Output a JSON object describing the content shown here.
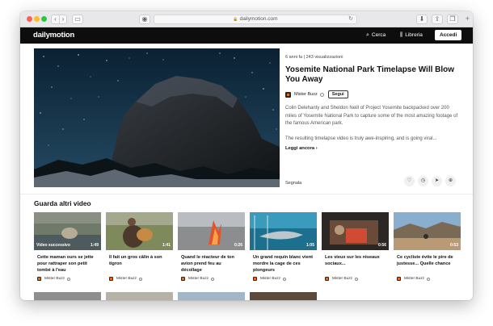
{
  "browser": {
    "url": "dailymotion.com"
  },
  "site": {
    "logo": "dailymotion",
    "search_label": "Cerca",
    "library_label": "Libreria",
    "login_label": "Accedi"
  },
  "video": {
    "meta_age": "6 anni fa",
    "meta_views": "243 visualizzazioni",
    "title": "Yosemite National Park Timelapse Will Blow You Away",
    "channel": "Mister Buzz",
    "follow_label": "Segui",
    "description_1": "Colin Delehanty and Sheldon Neill of Project Yosemite backpacked over 200 miles of Yosemite National Park to capture some of the most amazing footage of the famous American park.",
    "description_2": "The resulting timelapse video is truly awe-inspiring, and is going viral...",
    "read_more": "Leggi ancora",
    "report_label": "Segnala"
  },
  "related": {
    "section_title": "Guarda altri video",
    "items": [
      {
        "title": "Cette maman ours se jette pour rattraper son petit tombé à l'eau",
        "duration": "1:49",
        "badge": "Video successivo",
        "channel": "Mister Buzz"
      },
      {
        "title": "Il fait un gros câlin à son tigron",
        "duration": "1:41",
        "badge": "",
        "channel": "Mister Buzz"
      },
      {
        "title": "Quand le réacteur de ton avion prend feu au décollage",
        "duration": "0:26",
        "badge": "",
        "channel": "Mister Buzz"
      },
      {
        "title": "Un grand requin blanc vient mordre la cage de ces plongeurs",
        "duration": "1:05",
        "badge": "",
        "channel": "Mister Buzz"
      },
      {
        "title": "Les vieux sur les réseaux sociaux...",
        "duration": "0:56",
        "badge": "",
        "channel": "Mister Buzz"
      },
      {
        "title": "Ce cycliste évite le pire de justesse... Quelle chance",
        "duration": "0:53",
        "badge": "",
        "channel": "Mister Buzz"
      }
    ]
  }
}
